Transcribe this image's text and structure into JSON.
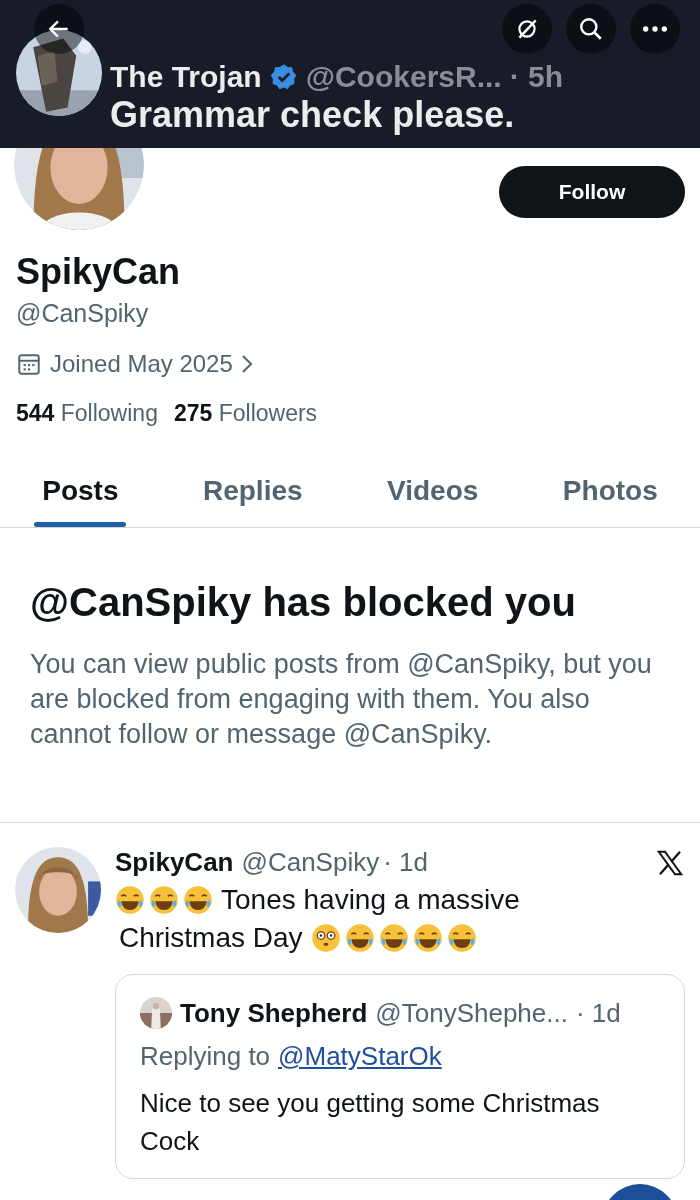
{
  "banner": {
    "author": "The Trojan",
    "verified": true,
    "handle": "@CookersR...",
    "time": "· 5h",
    "text": "Grammar check please."
  },
  "profile": {
    "name": "SpikyCan",
    "handle": "@CanSpiky",
    "joined": "Joined May 2025",
    "following_count": "544",
    "following_label": "Following",
    "followers_count": "275",
    "followers_label": "Followers",
    "follow_button": "Follow"
  },
  "tabs": [
    {
      "label": "Posts",
      "selected": true
    },
    {
      "label": "Replies",
      "selected": false
    },
    {
      "label": "Videos",
      "selected": false
    },
    {
      "label": "Photos",
      "selected": false
    }
  ],
  "blocked": {
    "title": "@CanSpiky has blocked you",
    "text": "You can view public posts from @CanSpiky, but you are blocked from engaging with them. You also cannot follow or message @CanSpiky."
  },
  "post": {
    "name": "SpikyCan",
    "handle": "@CanSpiky",
    "time": "· 1d",
    "text_1": "Tones having a massive",
    "text_2": "Christmas Day",
    "quote": {
      "name": "Tony Shepherd",
      "handle": "@TonyShephe...",
      "time": "· 1d",
      "replying_to": "Replying to",
      "mention": "@MatyStarOk",
      "text": "Nice to see you getting some Christmas Cock"
    }
  }
}
